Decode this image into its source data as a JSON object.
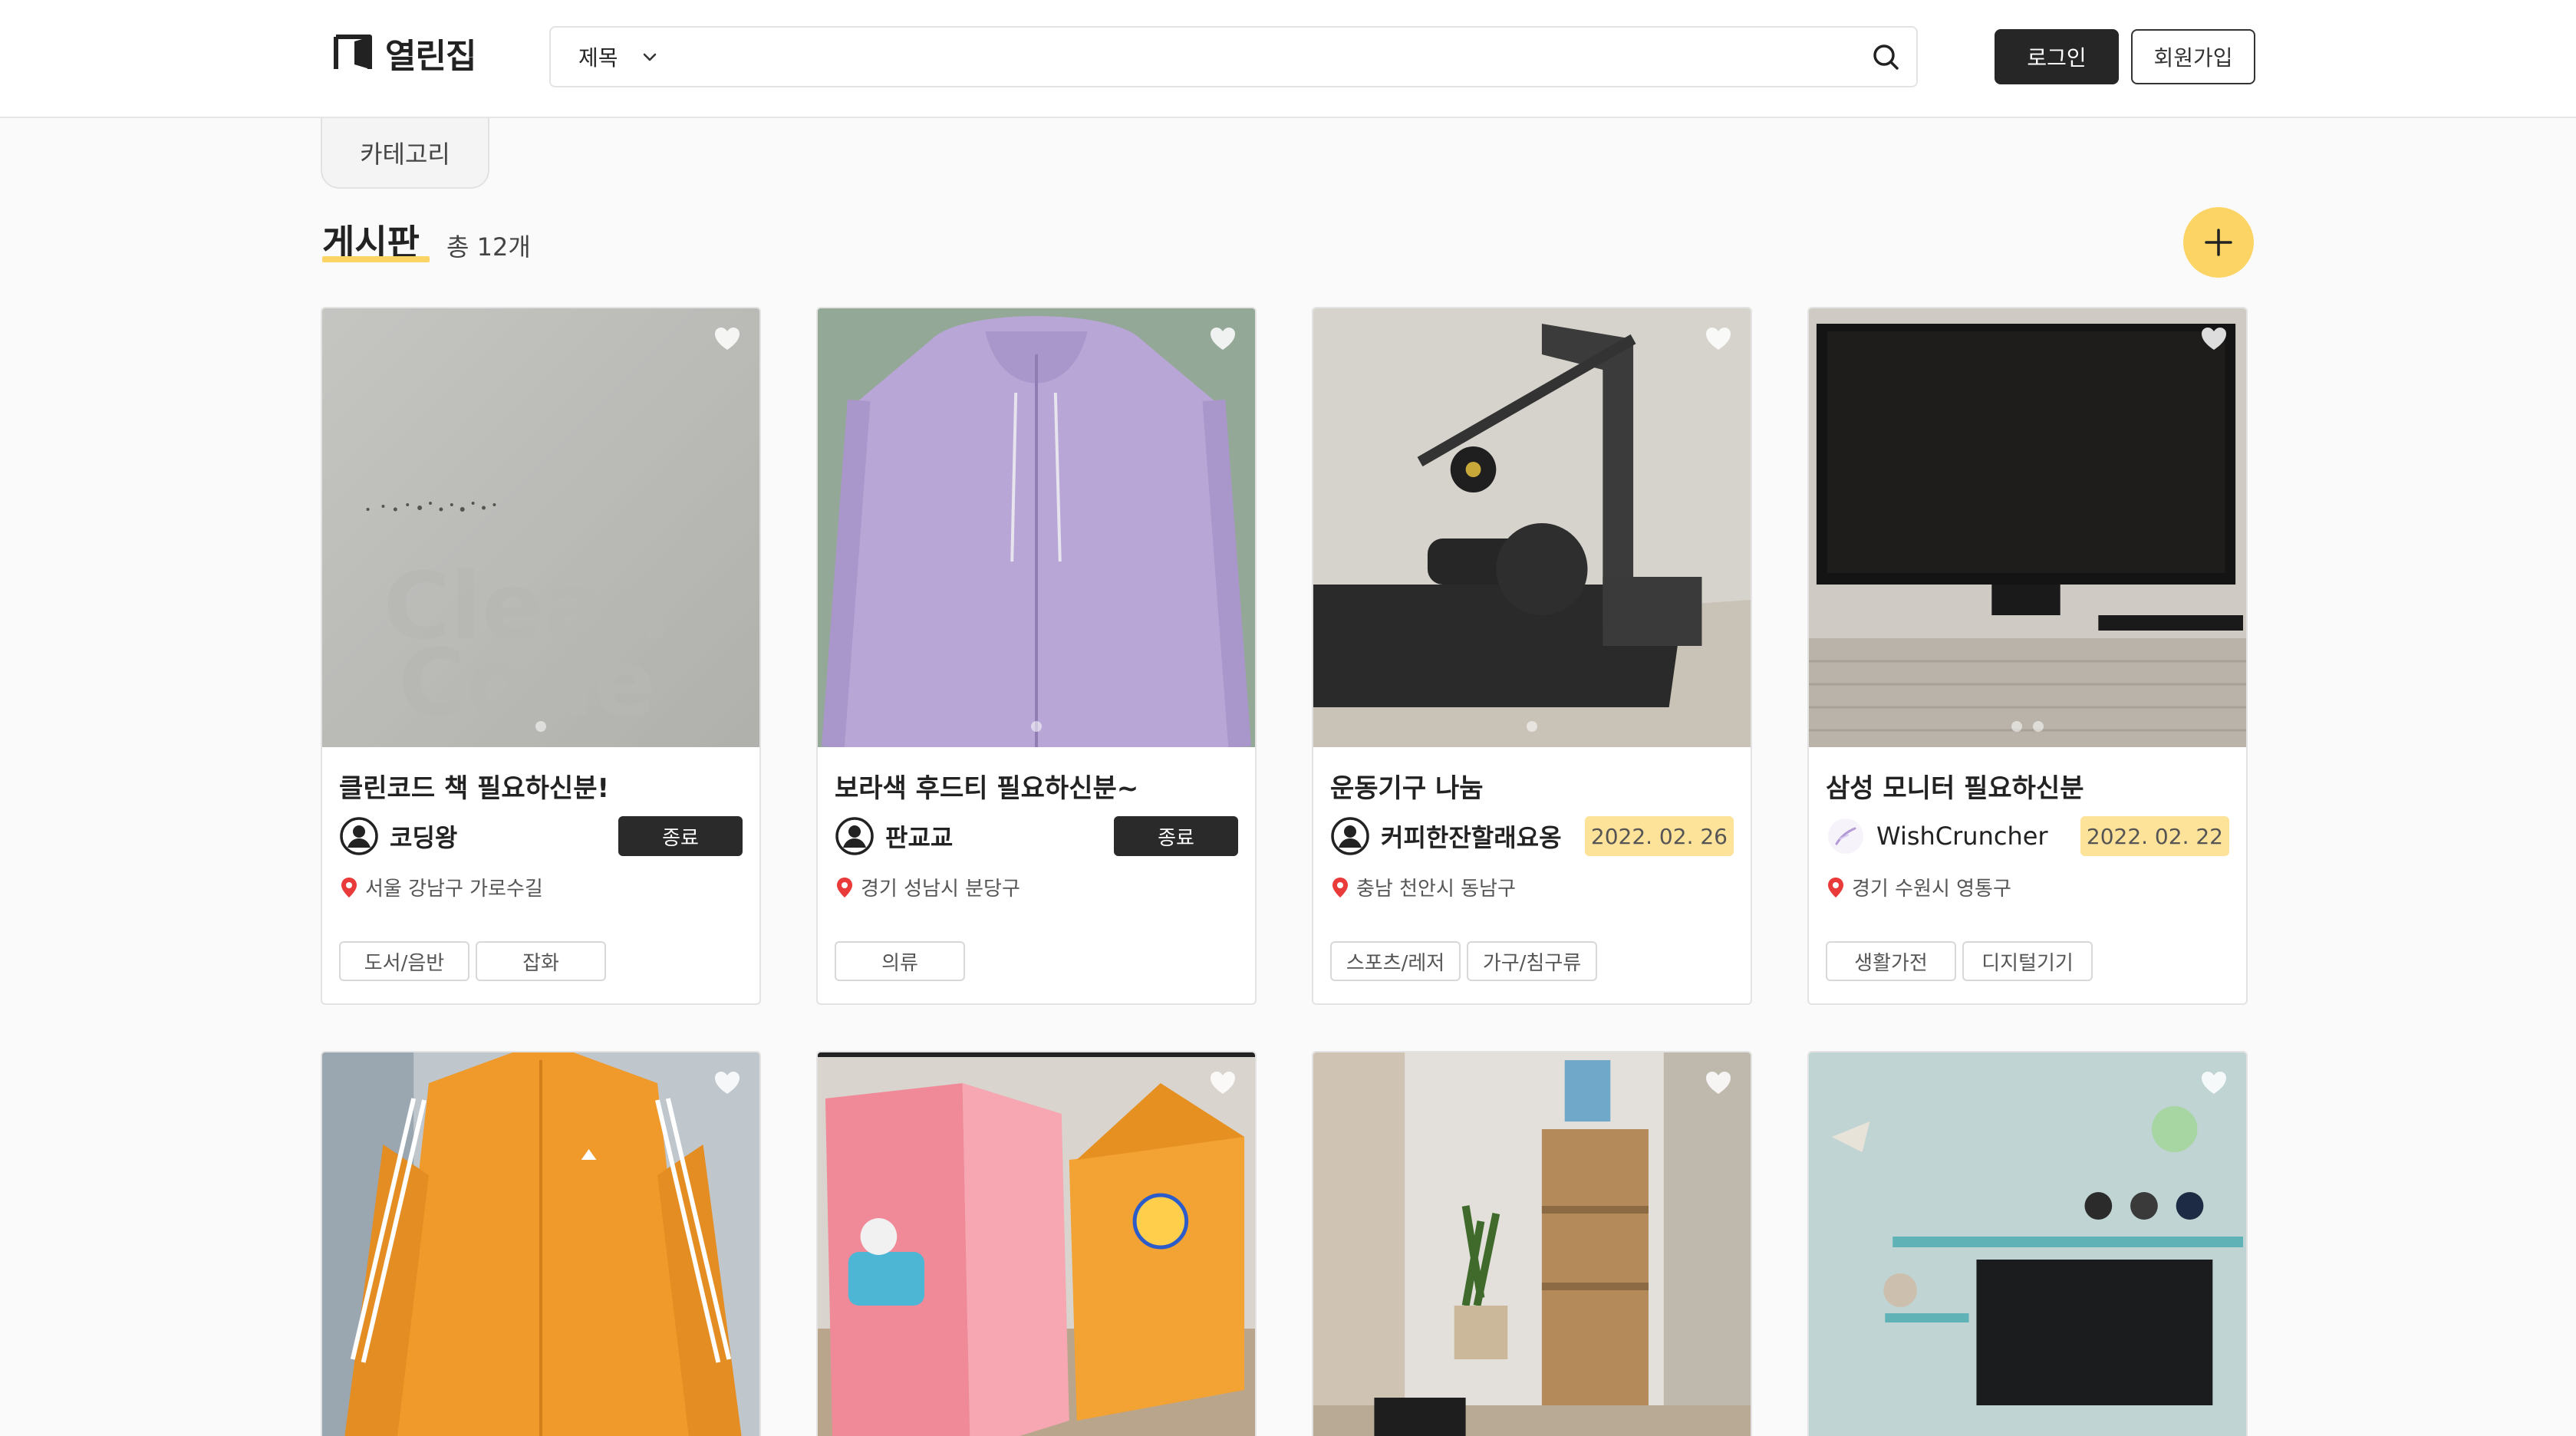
{
  "header": {
    "logo_text": "열린집",
    "search_select": "제목",
    "search_placeholder": "",
    "login_label": "로그인",
    "signup_label": "회원가입"
  },
  "category_tab": "카테고리",
  "board": {
    "title": "게시판",
    "count": "총 12개"
  },
  "colors": {
    "accent": "#fcd466",
    "dark_button": "#262626",
    "date_badge": "#fde29a"
  },
  "posts": [
    {
      "title": "클린코드 책 필요하신분!",
      "author": "코딩왕",
      "status": "종료",
      "location": "서울 강남구 가로수길",
      "tags": [
        "도서/음반",
        "잡화"
      ],
      "photo_dots": 1
    },
    {
      "title": "보라색 후드티 필요하신분~",
      "author": "판교교",
      "status": "종료",
      "location": "경기 성남시 분당구",
      "tags": [
        "의류"
      ],
      "photo_dots": 1
    },
    {
      "title": "운동기구 나눔",
      "author": "커피한잔할래요옹",
      "status": "2022. 02. 26",
      "location": "충남 천안시 동남구",
      "tags": [
        "스포츠/레저",
        "가구/침구류"
      ],
      "photo_dots": 1
    },
    {
      "title": "삼성 모니터 필요하신분",
      "author": "WishCruncher",
      "status": "2022. 02. 22",
      "location": "경기 수원시 영통구",
      "tags": [
        "생활가전",
        "디지털기기"
      ],
      "photo_dots": 2
    }
  ]
}
